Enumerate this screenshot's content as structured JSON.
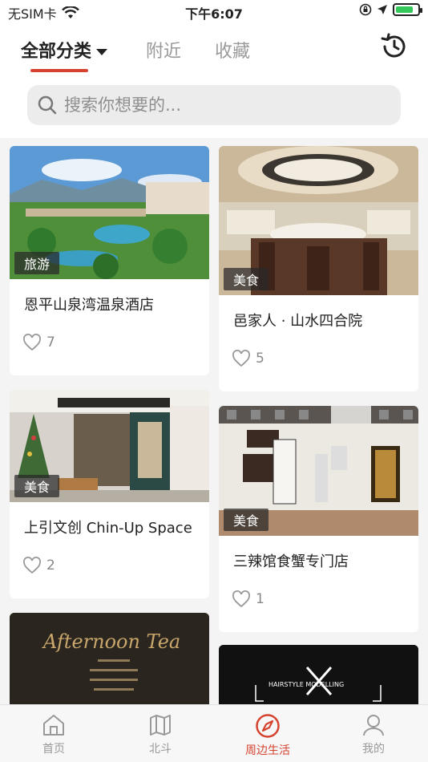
{
  "status_bar": {
    "carrier": "无SIM卡",
    "time": "下午6:07",
    "battery_level": 0.8
  },
  "top_tabs": [
    {
      "label": "全部分类",
      "active": true
    },
    {
      "label": "附近",
      "active": false
    },
    {
      "label": "收藏",
      "active": false
    }
  ],
  "search": {
    "placeholder": "搜索你想要的..."
  },
  "cards": [
    {
      "category": "旅游",
      "title": "恩平山泉湾温泉酒店",
      "likes": "7",
      "icon": "resort-photo"
    },
    {
      "category": "美食",
      "title": "邑家人 · 山水四合院",
      "likes": "5",
      "icon": "restaurant-photo"
    },
    {
      "category": "美食",
      "title": "上引文创 Chin-Up Space",
      "likes": "2",
      "icon": "cafe-photo"
    },
    {
      "category": "美食",
      "title": "三辣馆食蟹专门店",
      "likes": "1",
      "icon": "dining-hall-photo"
    },
    {
      "text": "Afternoon Tea"
    },
    {
      "text": "HAIRSTYLE MODELLING"
    }
  ],
  "tab_bar": [
    {
      "label": "首页",
      "icon": "home-icon",
      "active": false
    },
    {
      "label": "北斗",
      "icon": "map-icon",
      "active": false
    },
    {
      "label": "周边生活",
      "icon": "compass-icon",
      "active": true
    },
    {
      "label": "我的",
      "icon": "profile-icon",
      "active": false
    }
  ],
  "colors": {
    "accent": "#d5432f",
    "inactive": "#999999"
  }
}
